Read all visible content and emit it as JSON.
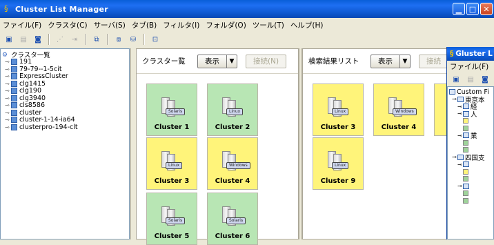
{
  "window": {
    "title": "Cluster List Manager",
    "controls": {
      "minimize": "▁",
      "maximize": "□",
      "close": "✕"
    }
  },
  "menu": [
    "ファイル(F)",
    "クラスタ(C)",
    "サーバ(S)",
    "タブ(B)",
    "フィルタ(I)",
    "フォルダ(O)",
    "ツール(T)",
    "ヘルプ(H)"
  ],
  "tree": {
    "root": "クラスタ一覧",
    "items": [
      "191",
      "79-79--1-5cit",
      "ExpressCluster",
      "clg1415",
      "clg190",
      "clg3940",
      "cls8586",
      "cluster",
      "cluster-1-14-ia64",
      "clusterpro-194-clt"
    ]
  },
  "panel_list": {
    "title": "クラスター覧",
    "show_label": "表示",
    "disconnect_label": "接続(N)",
    "clusters": [
      {
        "name": "Cluster 1",
        "os": "Solaris",
        "status": "green"
      },
      {
        "name": "Cluster 2",
        "os": "Linux",
        "status": "green"
      },
      {
        "name": "Cluster 3",
        "os": "Linux",
        "status": "yellow"
      },
      {
        "name": "Cluster 4",
        "os": "Windows",
        "status": "green"
      },
      {
        "name": "Cluster 5",
        "os": "Solaris",
        "status": "green"
      },
      {
        "name": "Cluster 6",
        "os": "Solaris",
        "status": "green"
      }
    ]
  },
  "panel_search": {
    "title": "検索結果リスト",
    "show_label": "表示",
    "disconnect_label": "接続",
    "clusters": [
      {
        "name": "Cluster 3",
        "os": "Linux",
        "status": "yellow"
      },
      {
        "name": "Cluster 4",
        "os": "Windows",
        "status": "yellow"
      },
      {
        "name": "Cluster 9",
        "os": "Linux",
        "status": "yellow"
      }
    ]
  },
  "second_window": {
    "title": "Gluster L",
    "menu": "ファイル(F)",
    "tree_root": "Custom Fi",
    "tree_items": [
      "東京本",
      "経",
      "人",
      "業",
      "四国支"
    ]
  },
  "colors": {
    "green": "#b8e6b4",
    "yellow": "#fff47a",
    "titlebar": "#0b54c9"
  }
}
